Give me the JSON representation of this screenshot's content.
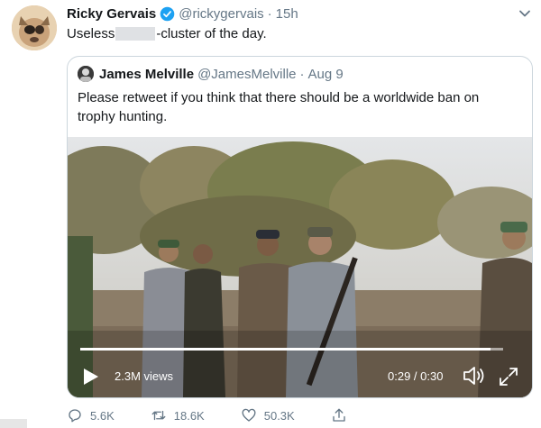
{
  "tweet": {
    "author_name": "Ricky Gervais",
    "handle": "@rickygervais",
    "separator": "·",
    "time": "15h",
    "text_before": "Useless",
    "text_after": "-cluster of the day."
  },
  "quoted": {
    "author_name": "James Melville",
    "handle": "@JamesMelville",
    "separator": "·",
    "time": "Aug 9",
    "text": "Please retweet if you think that there should be a worldwide ban on trophy hunting."
  },
  "video": {
    "views": "2.3M views",
    "duration": "0:29 / 0:30",
    "progress": 0.97
  },
  "actions": {
    "replies": "5.6K",
    "retweets": "18.6K",
    "likes": "50.3K"
  },
  "colors": {
    "text": "#14171a",
    "muted": "#657786",
    "verified": "#1da1f2",
    "border": "#ccd6dd"
  },
  "icons": [
    "verified-badge-icon",
    "chevron-down-icon",
    "play-icon",
    "volume-icon",
    "fullscreen-icon",
    "reply-icon",
    "retweet-icon",
    "like-icon",
    "share-icon"
  ]
}
